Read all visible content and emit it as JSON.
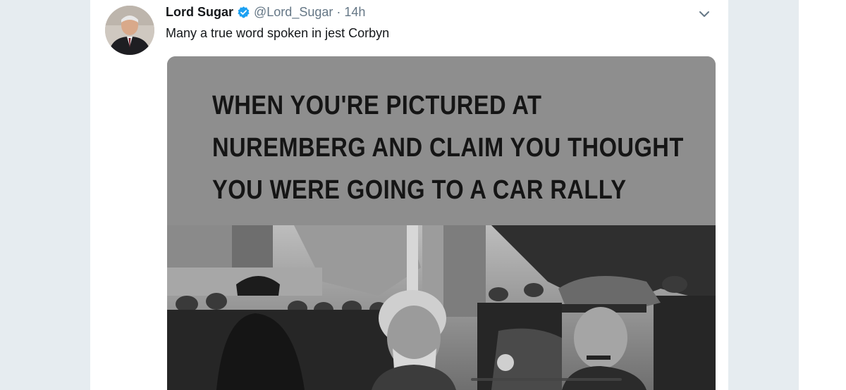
{
  "tweet": {
    "display_name": "Lord Sugar",
    "handle": "@Lord_Sugar",
    "separator": "·",
    "time": "14h",
    "text": "Many a true word spoken in jest Corbyn"
  },
  "media": {
    "meme_lines": [
      "WHEN YOU'RE PICTURED AT",
      "NUREMBERG AND CLAIM YOU THOUGHT",
      "YOU WERE GOING TO A CAR RALLY"
    ]
  },
  "icons": {
    "verified": "verified-badge-icon",
    "menu": "chevron-down-icon"
  },
  "colors": {
    "verified": "#1da1f2",
    "background": "#e6ecf0",
    "text": "#14171a",
    "secondary_text": "#657786"
  }
}
